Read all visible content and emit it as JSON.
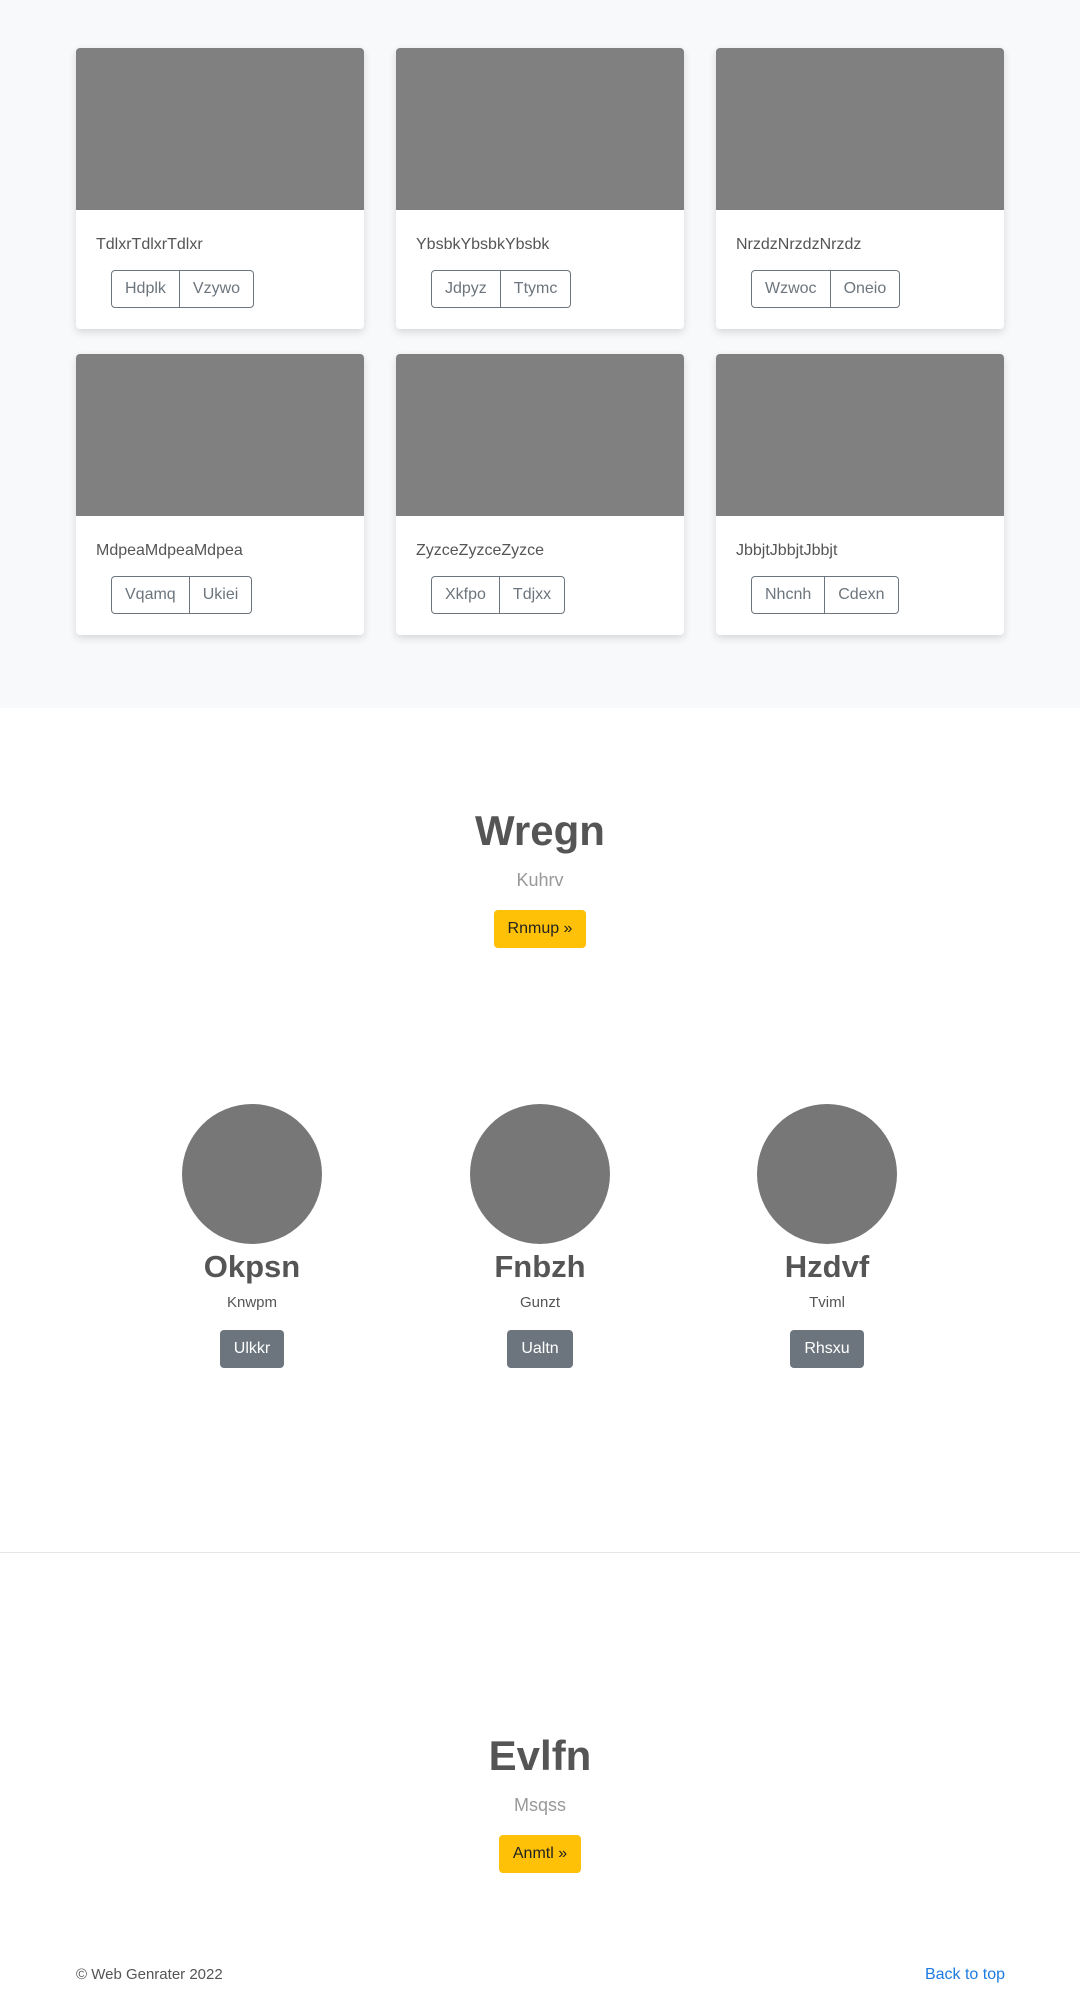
{
  "cards": [
    {
      "title": "TdlxrTdlxrTdlxr",
      "buttons": [
        "Hdplk",
        "Vzywo"
      ]
    },
    {
      "title": "YbsbkYbsbkYbsbk",
      "buttons": [
        "Jdpyz",
        "Ttymc"
      ]
    },
    {
      "title": "NrzdzNrzdzNrzdz",
      "buttons": [
        "Wzwoc",
        "Oneio"
      ]
    },
    {
      "title": "MdpeaMdpeaMdpea",
      "buttons": [
        "Vqamq",
        "Ukiei"
      ]
    },
    {
      "title": "ZyzceZyzceZyzce",
      "buttons": [
        "Xkfpo",
        "Tdjxx"
      ]
    },
    {
      "title": "JbbjtJbbjtJbbjt",
      "buttons": [
        "Nhcnh",
        "Cdexn"
      ]
    }
  ],
  "hero1": {
    "title": "Wregn",
    "subtitle": "Kuhrv",
    "button": "Rnmup »"
  },
  "profiles": [
    {
      "name": "Okpsn",
      "role": "Knwpm",
      "button": "Ulkkr"
    },
    {
      "name": "Fnbzh",
      "role": "Gunzt",
      "button": "Ualtn"
    },
    {
      "name": "Hzdvf",
      "role": "Tviml",
      "button": "Rhsxu"
    }
  ],
  "hero2": {
    "title": "Evlfn",
    "subtitle": "Msqss",
    "button": "Anmtl »"
  },
  "footer": {
    "copyright": "© Web Genrater 2022",
    "back_to_top": "Back to top"
  },
  "colors": {
    "accent": "#ffc107",
    "secondary": "#6c757d",
    "link": "#1e7be0",
    "placeholder": "#808080"
  }
}
